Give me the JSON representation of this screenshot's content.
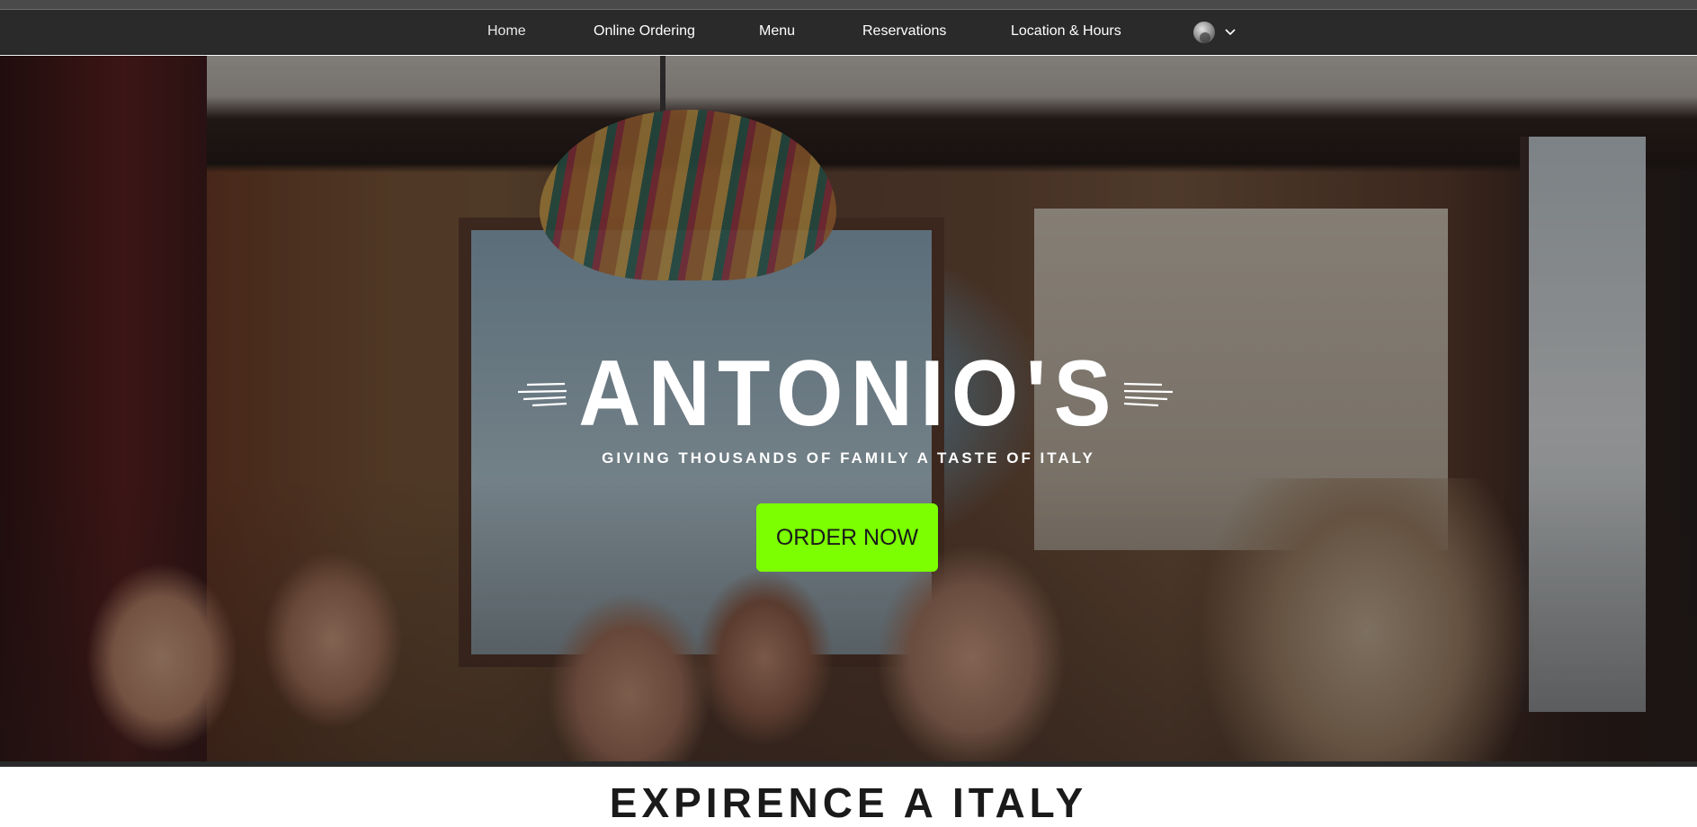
{
  "nav": {
    "items": [
      {
        "label": "Home",
        "active": true
      },
      {
        "label": "Online Ordering"
      },
      {
        "label": "Menu"
      },
      {
        "label": "Reservations"
      },
      {
        "label": "Location & Hours"
      }
    ],
    "account_icon": "user-avatar-icon",
    "account_menu_icon": "chevron-down-icon"
  },
  "hero": {
    "title": "ANTONIO'S",
    "tagline": "GIVING THOUSANDS OF FAMILY A TASTE OF ITALY",
    "cta_label": "ORDER NOW",
    "decor_icon": "speed-lines-icon"
  },
  "section": {
    "title": "EXPIRENCE A ITALY"
  },
  "colors": {
    "nav_bg": "#2a2a2a",
    "cta_bg": "#7cff00",
    "text_light": "#ffffff",
    "text_dark": "#1a1a1a"
  }
}
